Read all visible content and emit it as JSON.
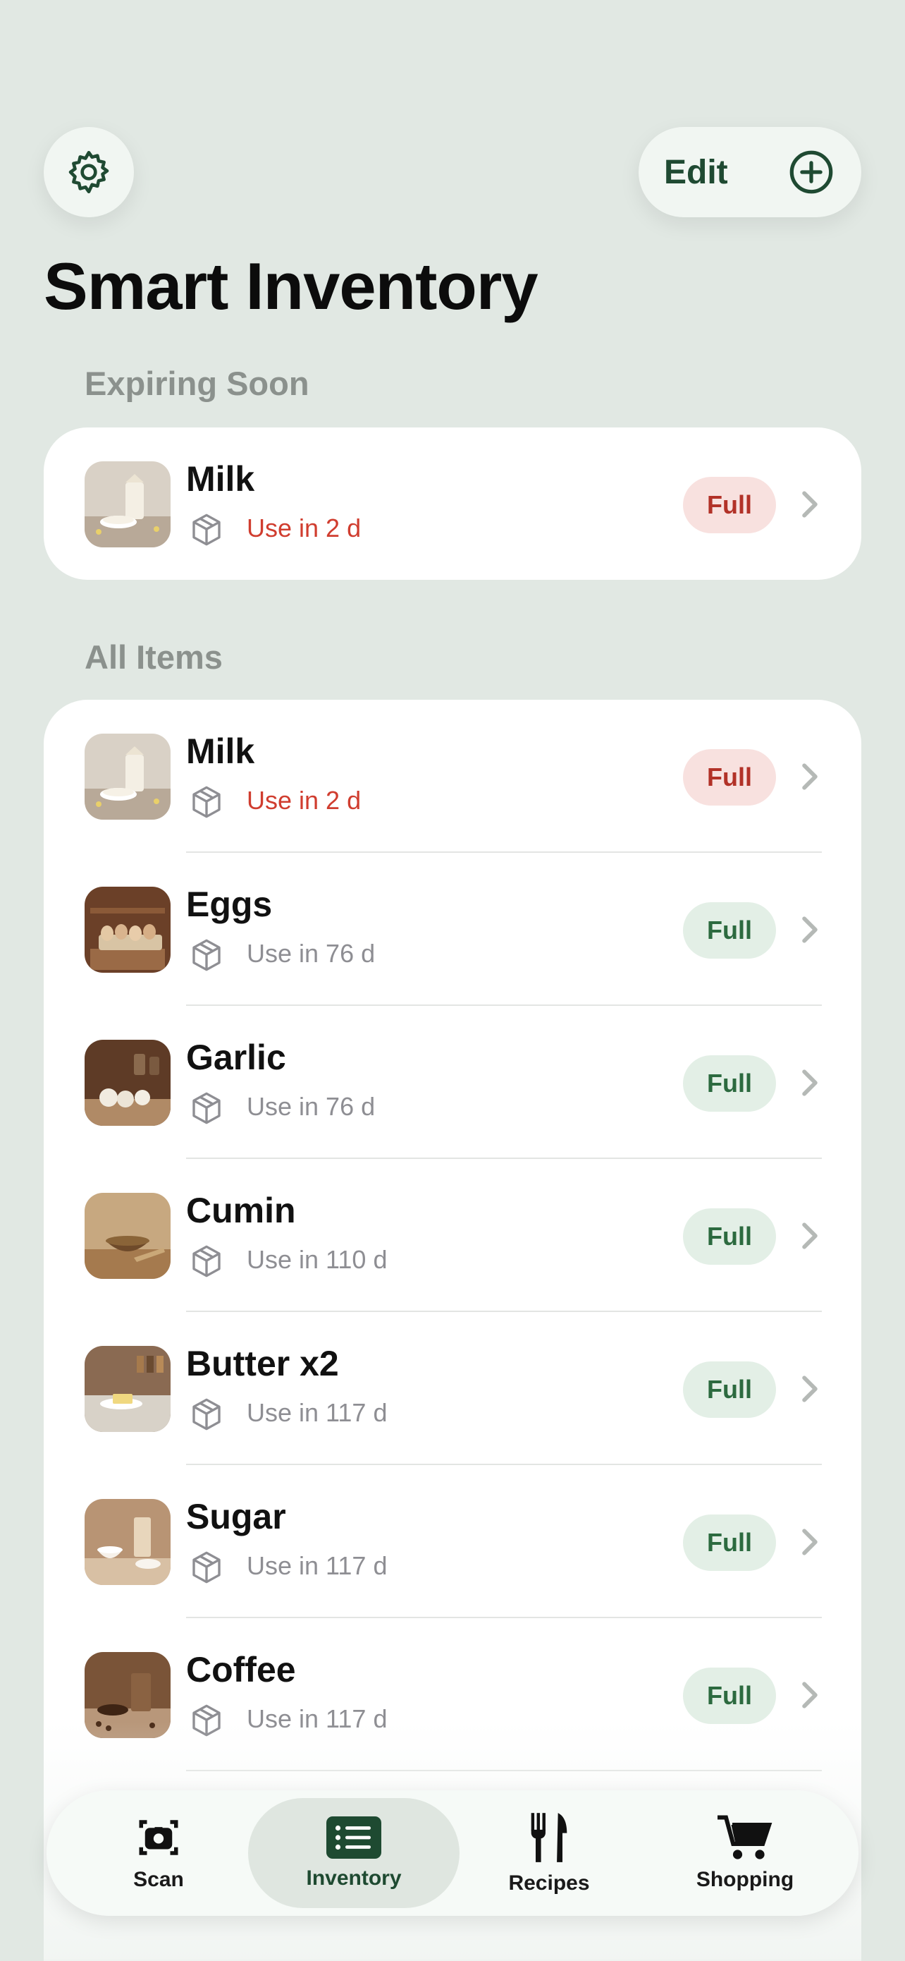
{
  "header": {
    "settings_icon": "gear-icon",
    "edit_label": "Edit",
    "add_icon": "plus-circle-icon",
    "title": "Smart Inventory"
  },
  "sections": {
    "expiring_title": "Expiring Soon",
    "all_title": "All Items"
  },
  "expiring_items": [
    {
      "name": "Milk",
      "expiry": "Use in 2 d",
      "status": "Full",
      "urgent": true
    }
  ],
  "items": [
    {
      "name": "Milk",
      "expiry": "Use in 2 d",
      "status": "Full",
      "urgent": true
    },
    {
      "name": "Eggs",
      "expiry": "Use in 76 d",
      "status": "Full",
      "urgent": false
    },
    {
      "name": "Garlic",
      "expiry": "Use in 76 d",
      "status": "Full",
      "urgent": false
    },
    {
      "name": "Cumin",
      "expiry": "Use in 110 d",
      "status": "Full",
      "urgent": false
    },
    {
      "name": "Butter x2",
      "expiry": "Use in 117 d",
      "status": "Full",
      "urgent": false
    },
    {
      "name": "Sugar",
      "expiry": "Use in 117 d",
      "status": "Full",
      "urgent": false
    },
    {
      "name": "Coffee",
      "expiry": "Use in 117 d",
      "status": "Full",
      "urgent": false
    }
  ],
  "tabbar": {
    "tabs": [
      {
        "label": "Scan",
        "icon": "camera-icon"
      },
      {
        "label": "Inventory",
        "icon": "list-icon",
        "active": true
      },
      {
        "label": "Recipes",
        "icon": "fork-knife-icon"
      },
      {
        "label": "Shopping",
        "icon": "cart-icon"
      }
    ]
  },
  "colors": {
    "background": "#e1e8e3",
    "accent": "#1f4a32",
    "urgent": "#d03d2f",
    "badge_green": "#e3efe6",
    "badge_red": "#f8e1df"
  }
}
